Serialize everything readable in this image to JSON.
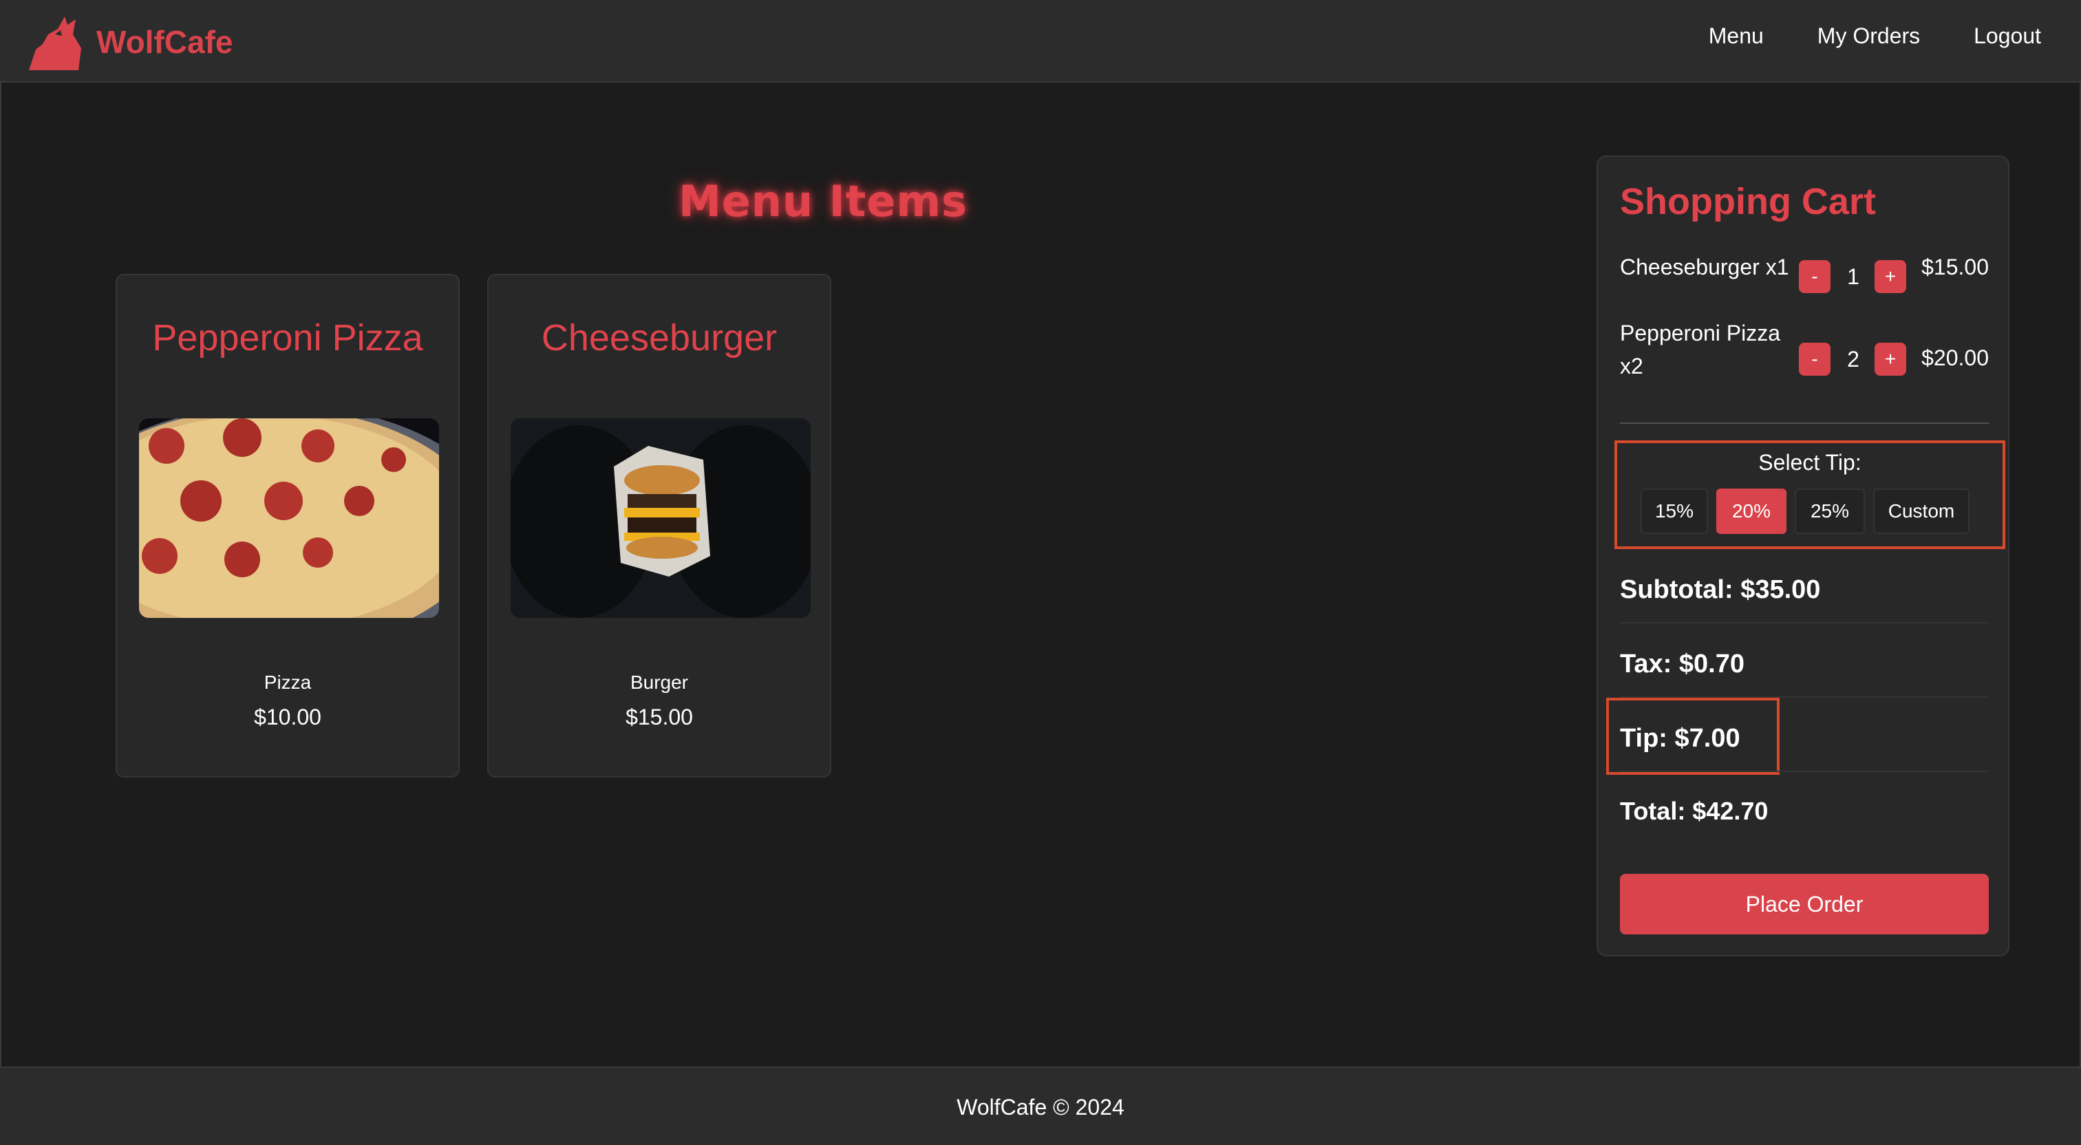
{
  "brand": {
    "name": "WolfCafe",
    "logo_icon": "wolf-howling-icon",
    "color": "#d9434b"
  },
  "nav": {
    "items": [
      {
        "label": "Menu"
      },
      {
        "label": "My Orders"
      },
      {
        "label": "Logout"
      }
    ]
  },
  "menu": {
    "title": "Menu Items",
    "items": [
      {
        "name": "Pepperoni Pizza",
        "description": "Pizza",
        "price": "$10.00",
        "image": "pepperoni-pizza-photo"
      },
      {
        "name": "Cheeseburger",
        "description": "Burger",
        "price": "$15.00",
        "image": "cheeseburger-photo"
      }
    ]
  },
  "cart": {
    "title": "Shopping Cart",
    "items": [
      {
        "name": "Cheeseburger x1",
        "quantity": "1",
        "price": "$15.00",
        "minus": "-",
        "plus": "+"
      },
      {
        "name": "Pepperoni Pizza x2",
        "quantity": "2",
        "price": "$20.00",
        "minus": "-",
        "plus": "+"
      }
    ],
    "tip": {
      "label": "Select Tip:",
      "options": [
        {
          "label": "15%",
          "active": false
        },
        {
          "label": "20%",
          "active": true
        },
        {
          "label": "25%",
          "active": false
        },
        {
          "label": "Custom",
          "active": false
        }
      ]
    },
    "subtotal": "Subtotal: $35.00",
    "tax": "Tax: $0.70",
    "tip_amount": "Tip: $7.00",
    "total": "Total: $42.70",
    "place_order": "Place Order"
  },
  "footer": {
    "text": "WolfCafe © 2024"
  },
  "colors": {
    "accent": "#d9434b",
    "highlight_border": "#d84a2c",
    "background": "#1c1c1c",
    "panel": "#282828"
  }
}
